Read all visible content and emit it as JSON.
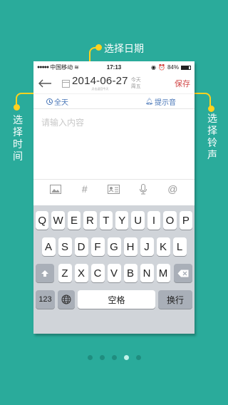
{
  "callouts": {
    "select_date": "选择日期",
    "select_time": "选择时间",
    "select_ringtone": "选择铃声"
  },
  "statusbar": {
    "carrier": "中国移动",
    "time": "17:13",
    "battery": "84%"
  },
  "navbar": {
    "date": "2014-06-27",
    "date_hint": "点击返回今天",
    "day_relative": "今天",
    "weekday": "周五",
    "save_label": "保存"
  },
  "toolbar": {
    "allday_label": "全天",
    "ring_label": "提示音"
  },
  "editor": {
    "placeholder": "请输入内容"
  },
  "accessory": {
    "icons": [
      "image-icon",
      "hashtag-icon",
      "contact-card-icon",
      "microphone-icon",
      "at-icon"
    ]
  },
  "keyboard": {
    "row1": [
      "Q",
      "W",
      "E",
      "R",
      "T",
      "Y",
      "U",
      "I",
      "O",
      "P"
    ],
    "row2": [
      "A",
      "S",
      "D",
      "F",
      "G",
      "H",
      "J",
      "K",
      "L"
    ],
    "row3": [
      "Z",
      "X",
      "C",
      "V",
      "B",
      "N",
      "M"
    ],
    "num_label": "123",
    "space_label": "空格",
    "return_label": "换行"
  },
  "pager": {
    "count": 5,
    "active_index": 3
  },
  "colors": {
    "background": "#2aab9b",
    "accent": "#ffd21f",
    "link_blue": "#4a77b8",
    "save_red": "#d24a4a"
  }
}
